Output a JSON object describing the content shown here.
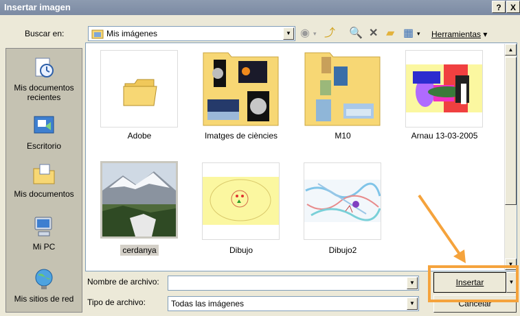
{
  "dialog": {
    "title": "Insertar imagen",
    "help": "?",
    "close": "X"
  },
  "lookin": {
    "label": "Buscar en:",
    "value": "Mis imágenes"
  },
  "toolbar": {
    "tools_label": "Herramientas"
  },
  "sidebar": {
    "items": [
      {
        "label": "Mis documentos recientes",
        "icon": "recent-documents-icon"
      },
      {
        "label": "Escritorio",
        "icon": "desktop-icon"
      },
      {
        "label": "Mis documentos",
        "icon": "my-documents-icon"
      },
      {
        "label": "Mi PC",
        "icon": "my-computer-icon"
      },
      {
        "label": "Mis sitios de red",
        "icon": "network-places-icon"
      }
    ]
  },
  "files": [
    {
      "name": "Adobe",
      "kind": "folder"
    },
    {
      "name": "Imatges de ciències",
      "kind": "folder"
    },
    {
      "name": "M10",
      "kind": "folder"
    },
    {
      "name": "Arnau 13-03-2005",
      "kind": "image"
    },
    {
      "name": "cerdanya",
      "kind": "image",
      "selected": true
    },
    {
      "name": "Dibujo",
      "kind": "image"
    },
    {
      "name": "Dibujo2",
      "kind": "image"
    }
  ],
  "filename": {
    "label": "Nombre de archivo:",
    "value": ""
  },
  "filetype": {
    "label": "Tipo de archivo:",
    "value": "Todas las imágenes"
  },
  "buttons": {
    "insert": "Insertar",
    "cancel": "Cancelar"
  },
  "colors": {
    "highlight": "#f5a33c",
    "folder": "#f7d774",
    "titlebar": "#8d9bb0"
  }
}
